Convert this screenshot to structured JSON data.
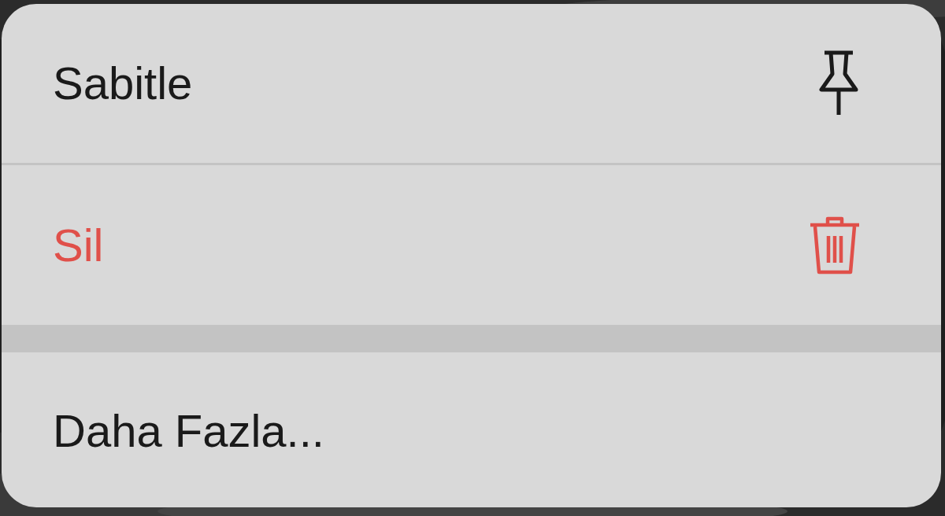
{
  "menu": {
    "groups": [
      {
        "items": [
          {
            "label": "Sabitle",
            "kind": "pin"
          },
          {
            "label": "Sil",
            "kind": "destructive"
          }
        ]
      },
      {
        "items": [
          {
            "label": "Daha Fazla...",
            "kind": "plain"
          }
        ]
      }
    ]
  }
}
